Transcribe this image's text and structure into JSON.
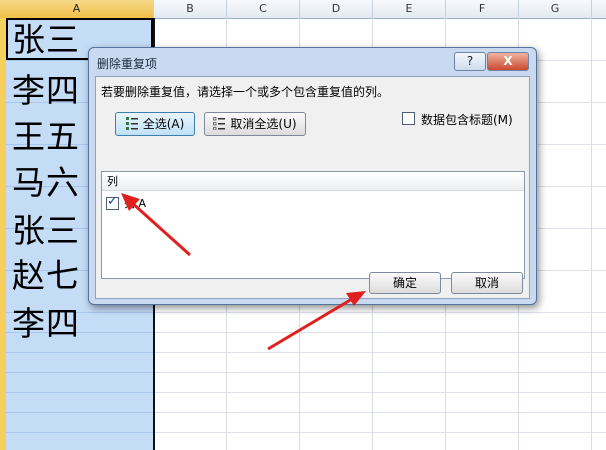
{
  "sheet": {
    "columns": [
      "A",
      "B",
      "C",
      "D",
      "E",
      "F",
      "G"
    ],
    "cells": [
      "张三",
      "李四",
      "王五",
      "马六",
      "张三",
      "赵七",
      "李四"
    ]
  },
  "dialog": {
    "title": "删除重复项",
    "help_label": "?",
    "close_label": "X",
    "instruction": "若要删除重复值，请选择一个或多个包含重复值的列。",
    "select_all_label": "全选(A)",
    "unselect_all_label": "取消全选(U)",
    "has_headers_label": "数据包含标题(M)",
    "has_headers_checked": false,
    "list_header": "列",
    "columns": [
      {
        "label": "列 A",
        "checked": true
      }
    ],
    "ok_label": "确定",
    "cancel_label": "取消"
  },
  "colors": {
    "arrow": "#e0201e",
    "selected_column": "#c5dcf7"
  }
}
